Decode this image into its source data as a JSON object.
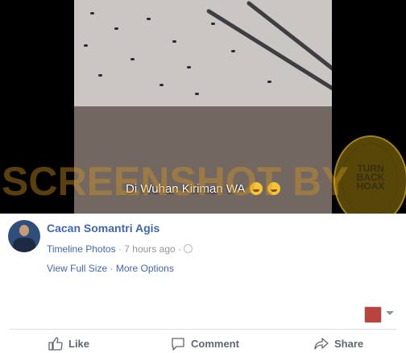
{
  "photo": {
    "caption": "Di Wuhan Kiriman WA",
    "caption_emojis": [
      "crying-face",
      "sad-face"
    ]
  },
  "watermark": {
    "text": "SCREENSHOT BY",
    "seal_lines": [
      "TURN",
      "BACK",
      "HOAX"
    ]
  },
  "post": {
    "author": "Cacan Somantri Agis",
    "album": "Timeline Photos",
    "time": "7 hours ago",
    "separator": "·",
    "privacy_icon": "globe-icon",
    "view_full_size": "View Full Size",
    "more_options": "More Options"
  },
  "actions": {
    "like": "Like",
    "comment": "Comment",
    "share": "Share"
  },
  "colors": {
    "link": "#4267b2",
    "secondary_text": "#90949c",
    "action_text": "#606770"
  }
}
